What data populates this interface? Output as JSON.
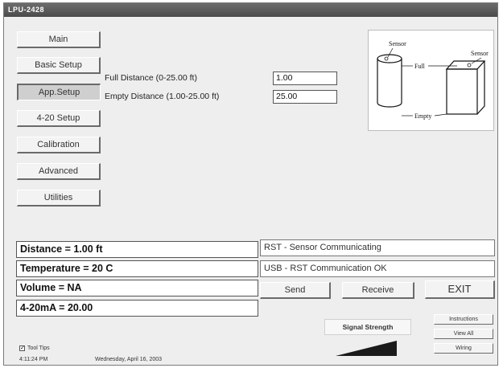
{
  "window": {
    "title": "LPU-2428"
  },
  "nav": {
    "items": [
      {
        "label": "Main"
      },
      {
        "label": "Basic Setup"
      },
      {
        "label": "App.Setup"
      },
      {
        "label": "4-20 Setup"
      },
      {
        "label": "Calibration"
      },
      {
        "label": "Advanced"
      },
      {
        "label": "Utilities"
      }
    ],
    "active": "App.Setup"
  },
  "form": {
    "full_label": "Full Distance (0-25.00 ft)",
    "full_value": "1.00",
    "empty_label": "Empty Distance (1.00-25.00 ft)",
    "empty_value": "25.00"
  },
  "diagram": {
    "sensor_left": "Sensor",
    "sensor_right": "Sensor",
    "full": "Full",
    "empty": "Empty"
  },
  "readouts": {
    "distance": "Distance = 1.00 ft",
    "temperature": "Temperature = 20 C",
    "volume": "Volume = NA",
    "current": "4-20mA = 20.00"
  },
  "messages": {
    "sensor": "RST - Sensor Communicating",
    "usb": "USB - RST Communication OK"
  },
  "buttons": {
    "send": "Send",
    "receive": "Receive",
    "exit": "EXIT",
    "instructions": "Instructions",
    "view_all": "View All",
    "wiring": "Wiring"
  },
  "signal": {
    "label": "Signal Strength",
    "level": 1.0
  },
  "footer": {
    "tooltips_label": "Tool Tips",
    "tooltips_checked": true,
    "time": "4:11:24 PM",
    "date": "Wednesday, April 16, 2003"
  }
}
